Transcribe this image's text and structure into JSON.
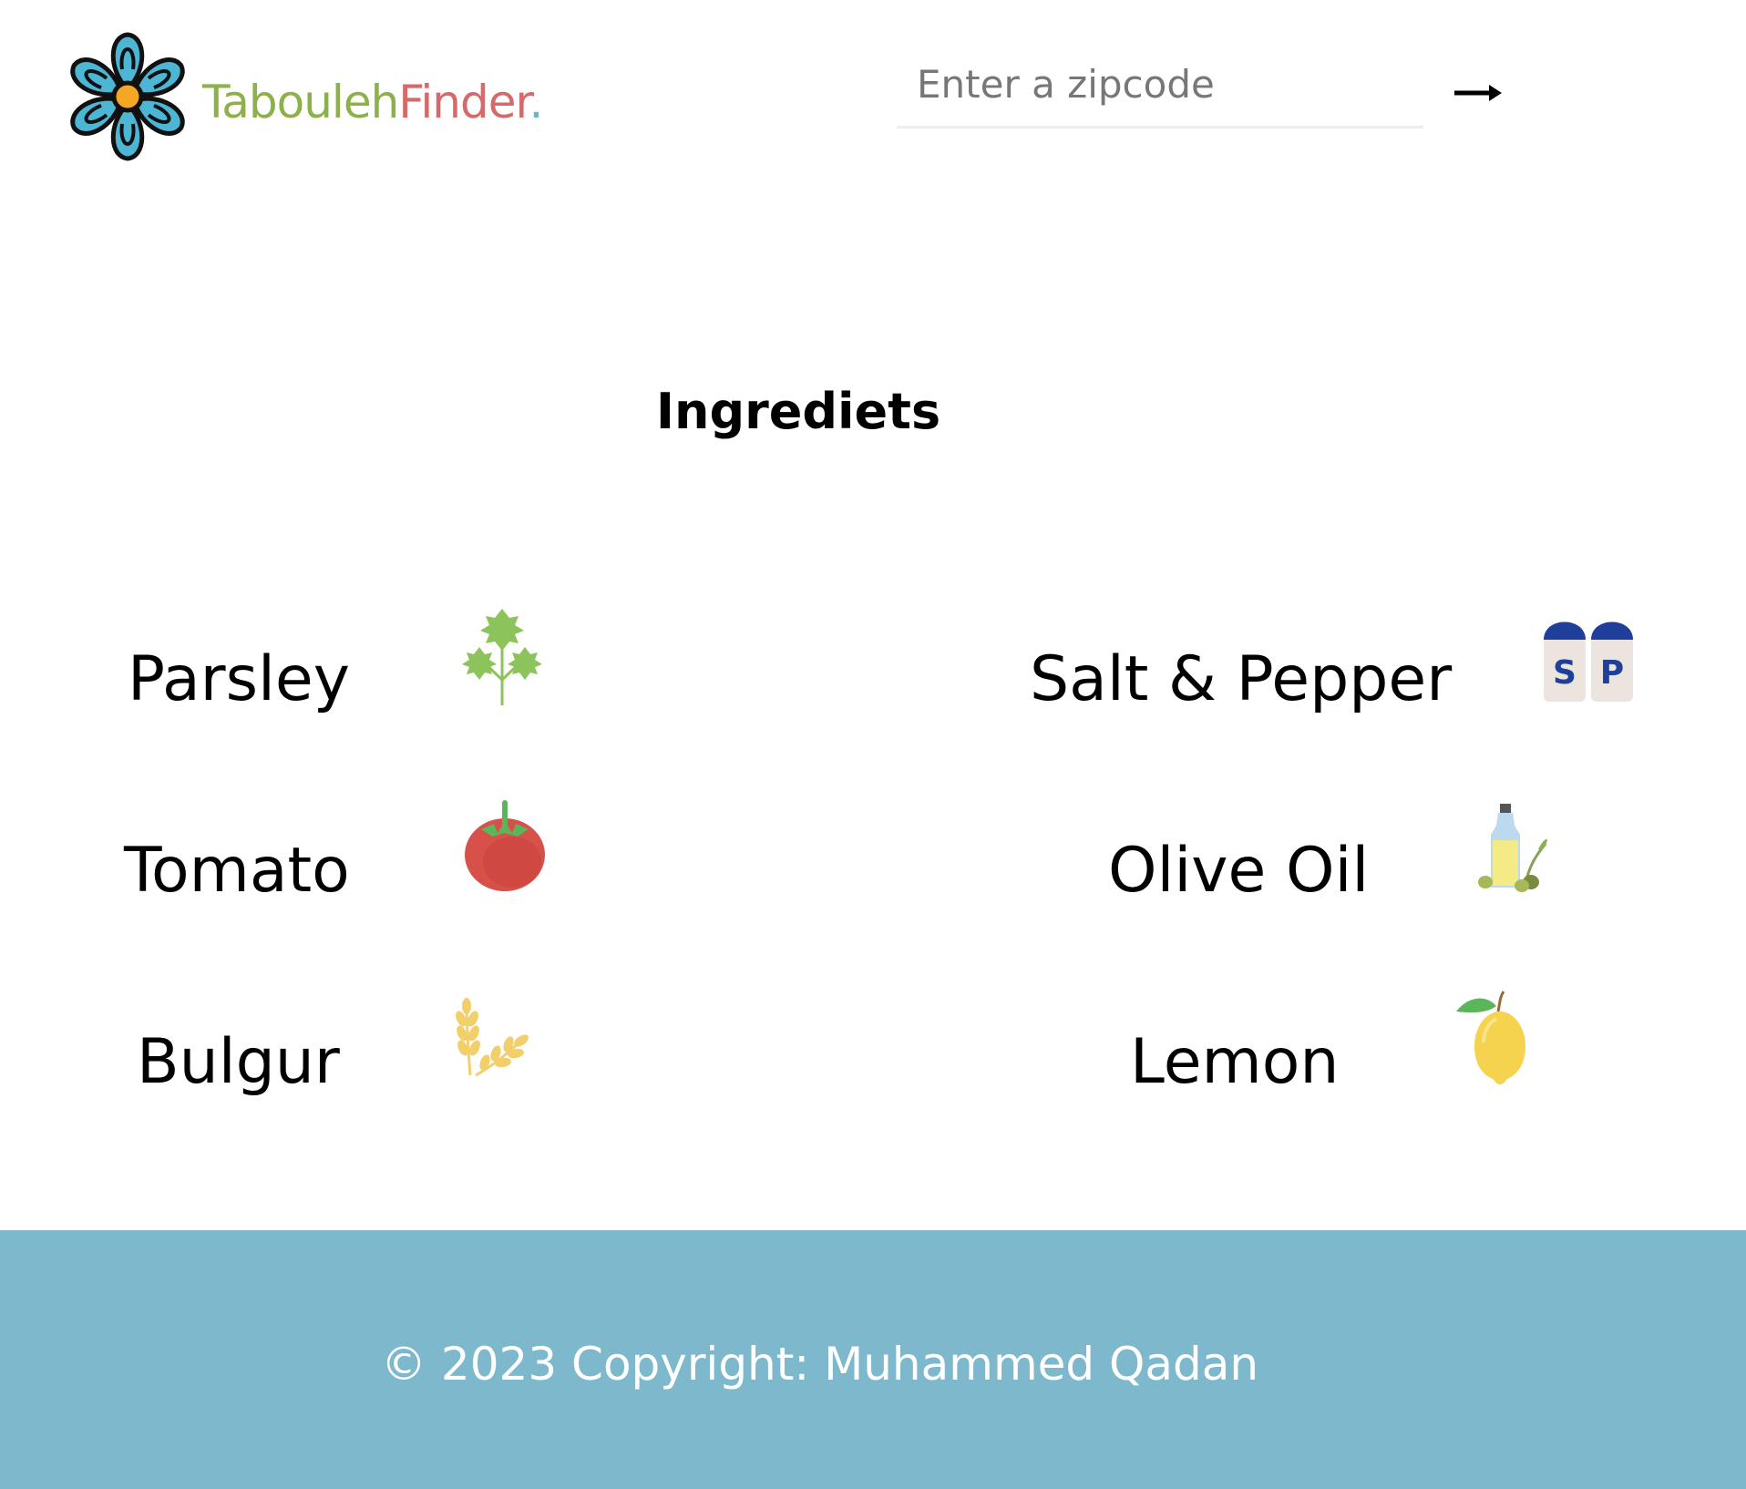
{
  "header": {
    "logo_word_1": "Tabouleh",
    "logo_word_2": "Finder",
    "logo_dot": ".",
    "logo_icon": "flower-icon",
    "zip_placeholder": "Enter a zipcode",
    "zip_value": "",
    "submit_icon": "arrow-right-icon",
    "submit_glyph": "→"
  },
  "main": {
    "title": "Ingrediets",
    "ingredients": [
      {
        "label": "Parsley",
        "icon": "parsley-icon"
      },
      {
        "label": "Salt & Pepper",
        "icon": "salt-pepper-icon"
      },
      {
        "label": "Tomato",
        "icon": "tomato-icon"
      },
      {
        "label": "Olive Oil",
        "icon": "olive-oil-icon"
      },
      {
        "label": "Bulgur",
        "icon": "wheat-icon"
      },
      {
        "label": "Lemon",
        "icon": "lemon-icon"
      }
    ]
  },
  "footer": {
    "copyright": "© 2023 Copyright: Muhammed Qadan"
  },
  "colors": {
    "brand_green": "#8db04a",
    "brand_red": "#d66a6a",
    "brand_blue": "#6fb2c9",
    "footer_bg": "#7db8cd"
  }
}
